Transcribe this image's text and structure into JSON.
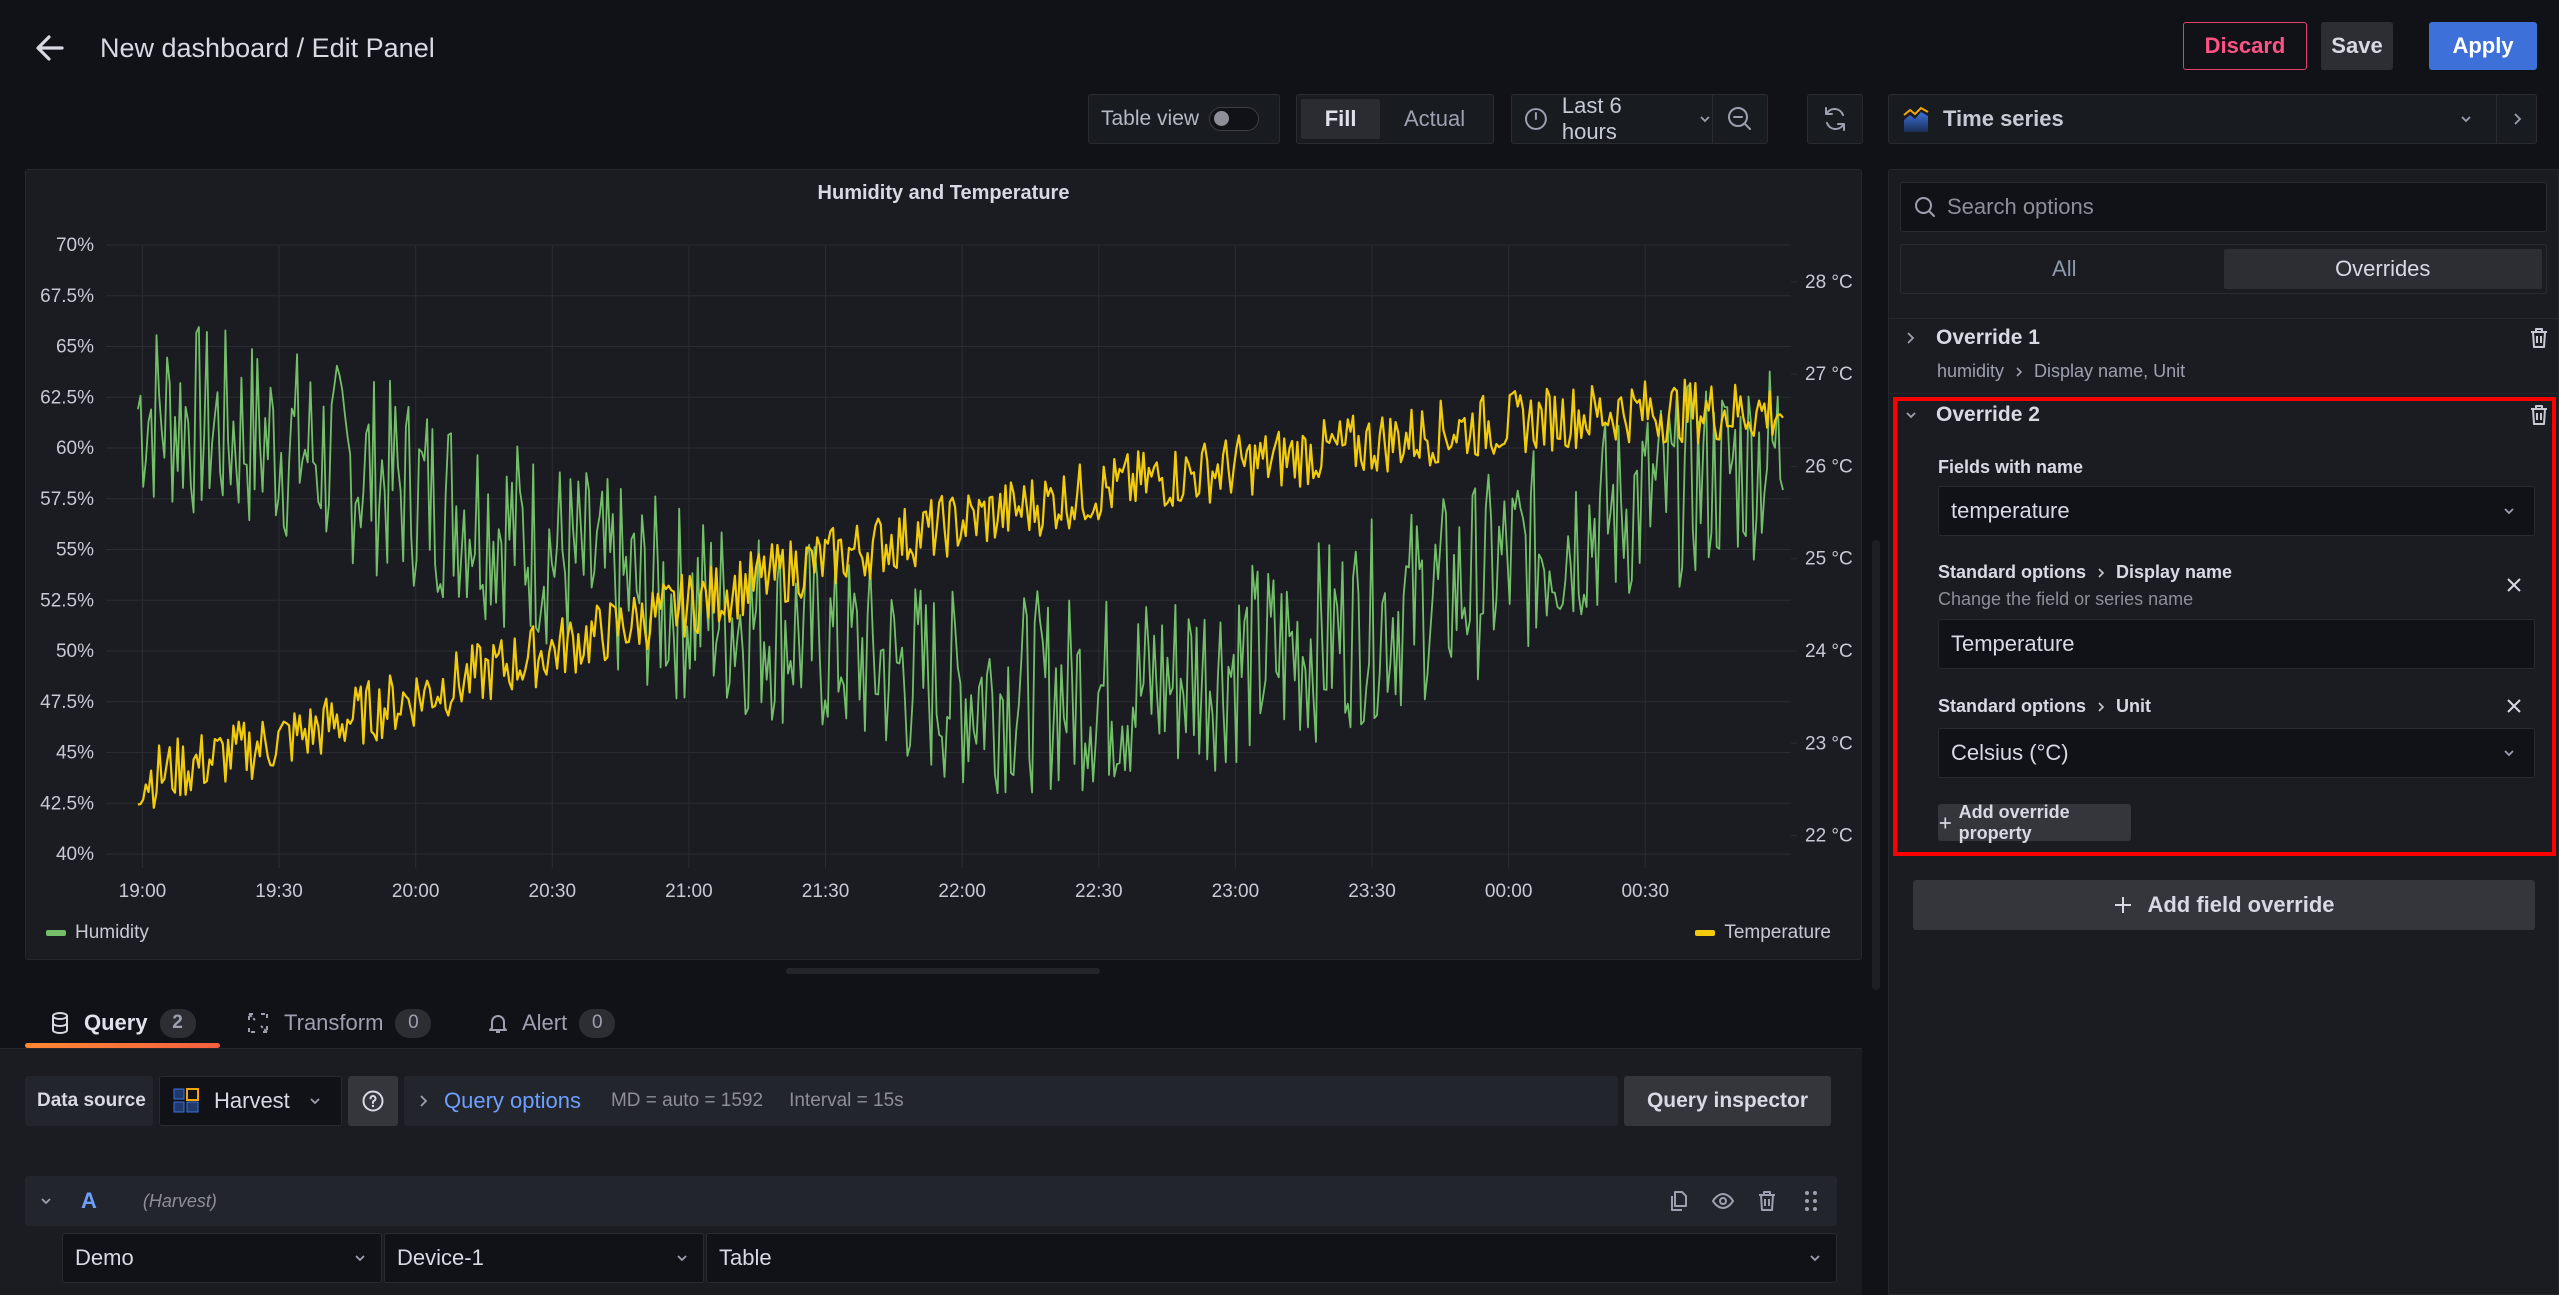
{
  "header": {
    "title": "New dashboard / Edit Panel",
    "back_icon": "arrow-left-icon",
    "buttons": {
      "discard": "Discard",
      "save": "Save",
      "apply": "Apply"
    }
  },
  "toolbar": {
    "table_view_label": "Table view",
    "table_view_enabled": false,
    "fill_label": "Fill",
    "actual_label": "Actual",
    "fill_selected": true,
    "time_range": "Last 6 hours",
    "visualization": "Time series"
  },
  "panel": {
    "title": "Humidity and Temperature"
  },
  "chart_data": {
    "type": "line",
    "title": "Humidity and Temperature",
    "xlabel": "",
    "x_ticks": [
      "19:00",
      "19:30",
      "20:00",
      "20:30",
      "21:00",
      "21:30",
      "22:00",
      "22:30",
      "23:00",
      "23:30",
      "00:00",
      "00:30"
    ],
    "x_range": [
      "18:52",
      "01:02"
    ],
    "left_axis": {
      "unit": "%",
      "ticks": [
        "40%",
        "42.5%",
        "45%",
        "47.5%",
        "50%",
        "52.5%",
        "55%",
        "57.5%",
        "60%",
        "62.5%",
        "65%",
        "67.5%",
        "70%"
      ],
      "ylim": [
        40,
        70
      ]
    },
    "right_axis": {
      "unit": "°C",
      "ticks": [
        "22 °C",
        "23 °C",
        "24 °C",
        "25 °C",
        "26 °C",
        "27 °C",
        "28 °C"
      ],
      "ylim": [
        21.8,
        28.4
      ]
    },
    "grid": true,
    "legend_placement": "bottom",
    "series": [
      {
        "name": "Humidity",
        "axis": "left",
        "color": "#73bf69",
        "trend": "noisy values: ~62% at 19:00 trending down to ~48% around 22:00, then rising back to ~60% by 01:00",
        "anchor_points": [
          [
            0,
            62
          ],
          [
            0.1,
            60
          ],
          [
            0.2,
            57
          ],
          [
            0.3,
            53
          ],
          [
            0.4,
            51
          ],
          [
            0.5,
            48
          ],
          [
            0.6,
            48
          ],
          [
            0.7,
            50
          ],
          [
            0.8,
            53
          ],
          [
            0.9,
            57
          ],
          [
            1.0,
            60
          ]
        ],
        "noise_amplitude": 5
      },
      {
        "name": "Temperature",
        "axis": "right",
        "color": "#f2cc0c",
        "trend": "noisy values: ~22.6 °C at 19:00 rising steadily to ~26.6 °C by 01:00",
        "anchor_points": [
          [
            0,
            22.6
          ],
          [
            0.1,
            23.1
          ],
          [
            0.2,
            23.7
          ],
          [
            0.3,
            24.3
          ],
          [
            0.4,
            24.9
          ],
          [
            0.5,
            25.4
          ],
          [
            0.6,
            25.8
          ],
          [
            0.7,
            26.1
          ],
          [
            0.8,
            26.4
          ],
          [
            0.9,
            26.6
          ],
          [
            1.0,
            26.6
          ]
        ],
        "noise_amplitude": 0.35
      }
    ]
  },
  "legend": [
    {
      "label": "Humidity",
      "color": "#73bf69"
    },
    {
      "label": "Temperature",
      "color": "#f2cc0c"
    }
  ],
  "query_tabs": [
    {
      "label": "Query",
      "count": "2",
      "icon": "database-icon",
      "active": true
    },
    {
      "label": "Transform",
      "count": "0",
      "icon": "transform-icon",
      "active": false
    },
    {
      "label": "Alert",
      "count": "0",
      "icon": "bell-icon",
      "active": false
    }
  ],
  "query": {
    "data_source_label": "Data source",
    "data_source": "Harvest",
    "options_label": "Query options",
    "md": "MD = auto = 1592",
    "interval": "Interval = 15s",
    "inspector_label": "Query inspector",
    "row": {
      "ref_id": "A",
      "ds_name": "(Harvest)",
      "selects": [
        "Demo",
        "Device-1",
        "Table"
      ]
    }
  },
  "options": {
    "search_placeholder": "Search options",
    "tabs": [
      {
        "label": "All",
        "active": false
      },
      {
        "label": "Overrides",
        "active": true
      }
    ],
    "overrides": [
      {
        "title": "Override 1",
        "expanded": false,
        "matcher": "humidity",
        "properties_summary": "Display name, Unit"
      },
      {
        "title": "Override 2",
        "expanded": true,
        "matcher_label": "Fields with name",
        "matcher_value": "temperature",
        "properties": [
          {
            "category": "Standard options",
            "name": "Display name",
            "description": "Change the field or series name",
            "value": "Temperature"
          },
          {
            "category": "Standard options",
            "name": "Unit",
            "value": "Celsius (°C)"
          }
        ],
        "add_property_label": "Add override property"
      }
    ],
    "add_field_override_label": "Add field override"
  },
  "highlight_color": "#ff0000"
}
